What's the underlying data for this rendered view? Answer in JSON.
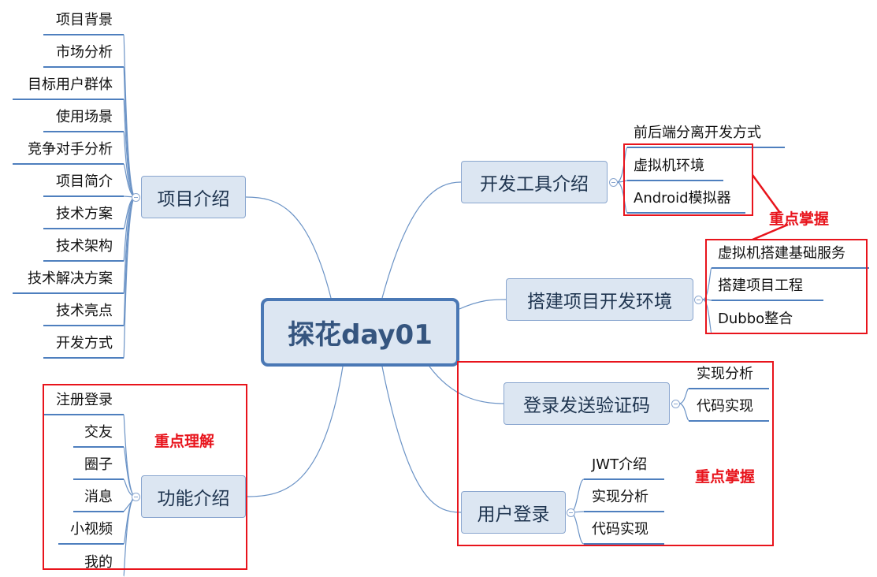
{
  "center": {
    "label": "探花day01"
  },
  "project_intro": {
    "label": "项目介绍",
    "children": [
      "项目背景",
      "市场分析",
      "目标用户群体",
      "使用场景",
      "竞争对手分析",
      "项目简介",
      "技术方案",
      "技术架构",
      "技术解决方案",
      "技术亮点",
      "开发方式"
    ]
  },
  "feature_intro": {
    "label": "功能介绍",
    "children": [
      "注册登录",
      "交友",
      "圈子",
      "消息",
      "小视频",
      "我的"
    ],
    "note": "重点理解"
  },
  "dev_tools": {
    "label": "开发工具介绍",
    "children": [
      "前后端分离开发方式",
      "虚拟机环境",
      "Android模拟器"
    ]
  },
  "build_env": {
    "label": "搭建项目开发环境",
    "children": [
      "虚拟机搭建基础服务",
      "搭建项目工程",
      "Dubbo整合"
    ]
  },
  "login_sms": {
    "label": "登录发送验证码",
    "children": [
      "实现分析",
      "代码实现"
    ]
  },
  "user_login": {
    "label": "用户登录",
    "children": [
      "JWT介绍",
      "实现分析",
      "代码实现"
    ]
  },
  "notes": {
    "master_top": "重点掌握",
    "master_bottom": "重点掌握"
  },
  "colors": {
    "node_fill": "#dce6f2",
    "node_border": "#8aa6cf",
    "branch_line": "#6b93c6",
    "leaf_underline": "#4e7fbe",
    "highlight": "#e8141c"
  }
}
